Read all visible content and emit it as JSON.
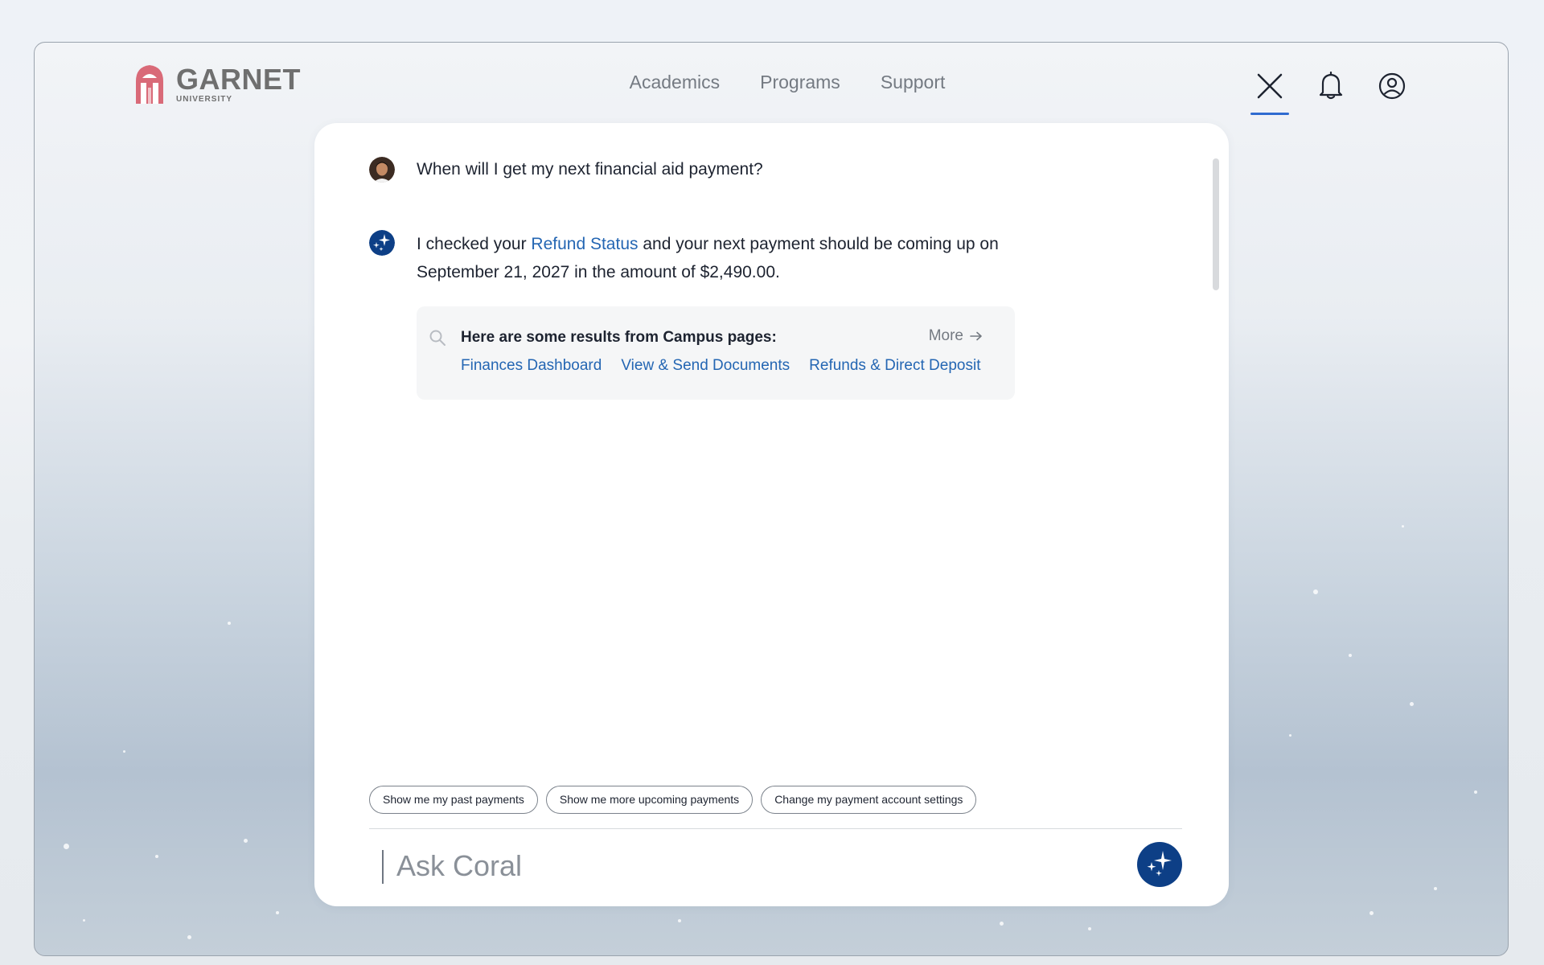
{
  "header": {
    "logo_word": "GARNET",
    "logo_sub": "UNIVERSITY",
    "nav": [
      "Academics",
      "Programs",
      "Support"
    ],
    "icons": [
      "close-icon",
      "bell-icon",
      "account-icon"
    ]
  },
  "chat": {
    "user_message": "When will I get my next financial aid payment?",
    "bot_message": {
      "before_link": "I checked your ",
      "link": "Refund Status",
      "after_link": " and your next payment should be coming up on September 21, 2027 in the amount of $2,490.00."
    },
    "results": {
      "title": "Here are some results from Campus pages:",
      "more_label": "More",
      "links": [
        "Finances Dashboard",
        "View & Send Documents",
        "Refunds & Direct Deposit"
      ]
    },
    "suggestions": [
      "Show me my past payments",
      "Show me more upcoming payments",
      "Change my payment account settings"
    ],
    "input_placeholder": "Ask Coral"
  },
  "colors": {
    "accent": "#0d3f86",
    "link": "#2466b3",
    "logo": "#d96a78"
  }
}
